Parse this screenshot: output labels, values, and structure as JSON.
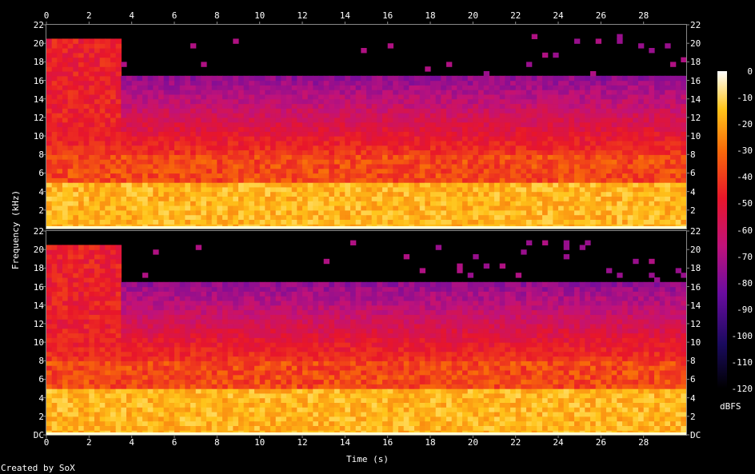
{
  "chart_data": {
    "type": "heatmap",
    "title": "",
    "xlabel": "Time (s)",
    "ylabel": "Frequency (kHz)",
    "colorbar_label": "dBFS",
    "x_range_s": [
      0,
      30
    ],
    "y_range_khz": [
      0,
      22
    ],
    "x_ticks": [
      "0",
      "2",
      "4",
      "6",
      "8",
      "10",
      "12",
      "14",
      "16",
      "18",
      "20",
      "22",
      "24",
      "26",
      "28"
    ],
    "x_tick_values": [
      0,
      2,
      4,
      6,
      8,
      10,
      12,
      14,
      16,
      18,
      20,
      22,
      24,
      26,
      28
    ],
    "y_ticks_top": [
      "22",
      "20",
      "18",
      "16",
      "14",
      "12",
      "10",
      "8",
      "6",
      "4",
      "2"
    ],
    "y_ticks_bottom": [
      "22",
      "20",
      "18",
      "16",
      "14",
      "12",
      "10",
      "8",
      "6",
      "4",
      "2",
      "DC"
    ],
    "y_tick_values": [
      22,
      20,
      18,
      16,
      14,
      12,
      10,
      8,
      6,
      4,
      2,
      0
    ],
    "colorbar_ticks": [
      "0",
      "-10",
      "-20",
      "-30",
      "-40",
      "-50",
      "-60",
      "-70",
      "-80",
      "-90",
      "-100",
      "-110",
      "-120"
    ],
    "colorbar_range_db": [
      -120,
      0
    ],
    "channels": 2,
    "palette": [
      "#000000",
      "#1a0a5e",
      "#6a0ca0",
      "#c0127a",
      "#e8162a",
      "#f86a0a",
      "#ffc41a",
      "#ffffc8"
    ],
    "spectral_features": {
      "lowpass_cutoff_khz_before_3_3s": 20,
      "lowpass_cutoff_khz_after_3_3s": 16,
      "transition_time_s": 3.3,
      "bright_band_khz": [
        0,
        5
      ],
      "dense_band_khz": [
        5,
        8
      ]
    }
  },
  "footer": {
    "credit": "Created by SoX"
  }
}
